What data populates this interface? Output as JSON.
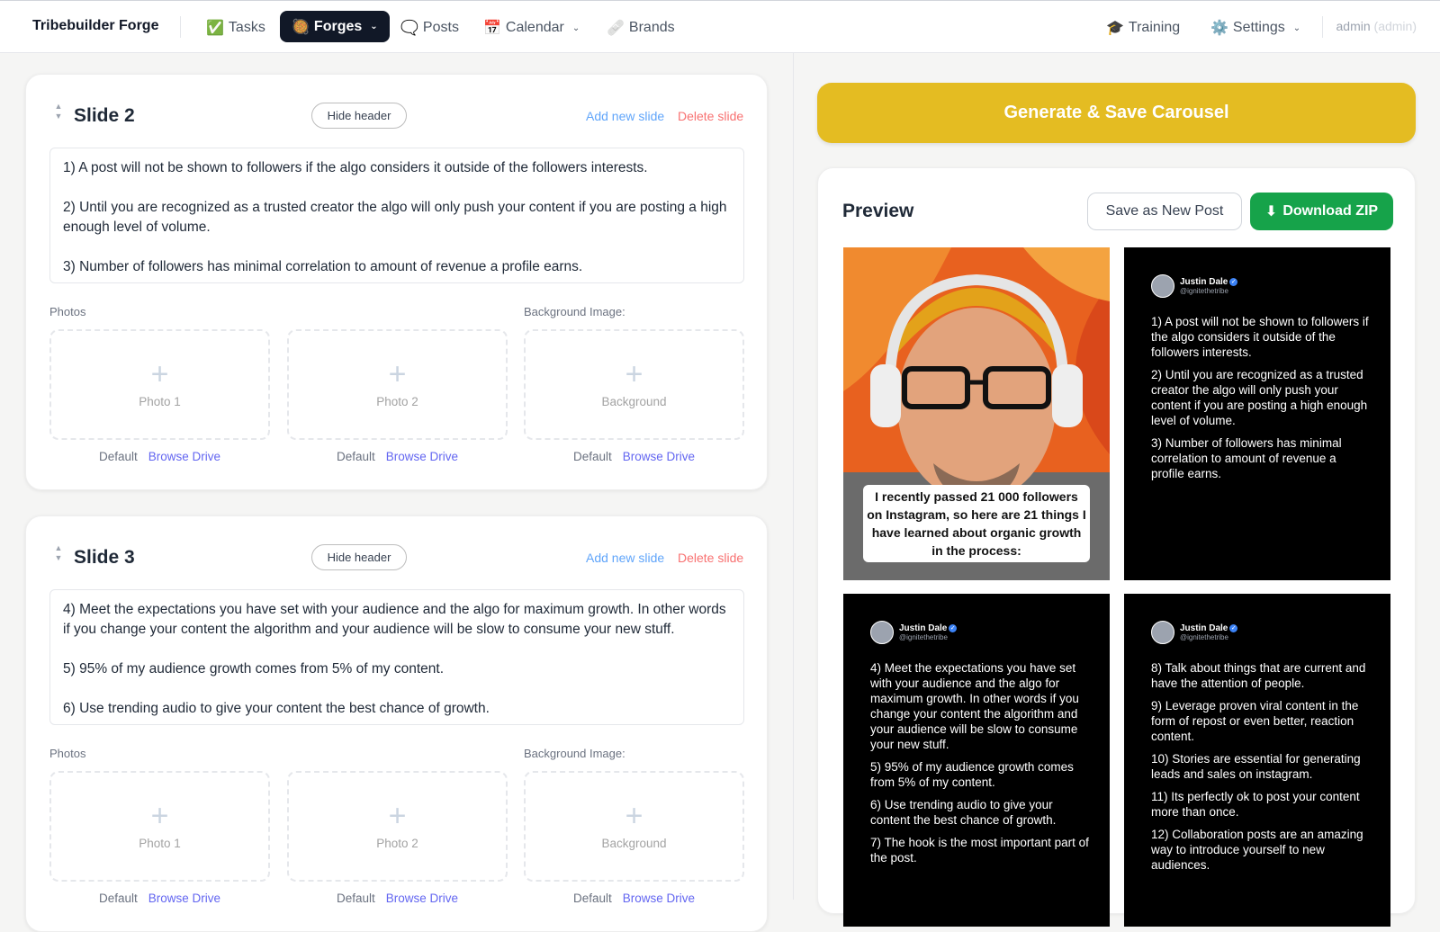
{
  "nav": {
    "brand": "Tribebuilder Forge",
    "items": [
      {
        "icon": "✅",
        "label": "Tasks"
      },
      {
        "icon": "🥘",
        "label": "Forges"
      },
      {
        "icon": "🗨️",
        "label": "Posts"
      },
      {
        "icon": "📅",
        "label": "Calendar"
      },
      {
        "icon": "🩹",
        "label": "Brands"
      }
    ],
    "training": {
      "icon": "🎓",
      "label": "Training"
    },
    "settings": {
      "icon": "⚙️",
      "label": "Settings"
    },
    "user": "admin",
    "role": "(admin)"
  },
  "slides": [
    {
      "title": "Slide 2",
      "hide_header": "Hide header",
      "add": "Add new slide",
      "delete": "Delete slide",
      "text": "1) A post will not be shown to followers if the algo considers it outside of the followers interests.\n\n2) Until you are recognized as a trusted creator the algo will only push your content if you are posting a high enough level of volume.\n\n3) Number of followers has minimal correlation to amount of revenue a profile earns.",
      "photos_label": "Photos",
      "bg_label": "Background Image:",
      "drops": [
        "Photo 1",
        "Photo 2",
        "Background"
      ],
      "default": "Default",
      "browse": "Browse Drive"
    },
    {
      "title": "Slide 3",
      "hide_header": "Hide header",
      "add": "Add new slide",
      "delete": "Delete slide",
      "text": "4) Meet the expectations you have set with your audience and the algo for maximum growth. In other words if you change your content the algorithm and your audience will be slow to consume your new stuff.\n\n5) 95% of my audience growth comes from 5% of my content.\n\n6) Use trending audio to give your content the best chance of growth.",
      "photos_label": "Photos",
      "bg_label": "Background Image:",
      "drops": [
        "Photo 1",
        "Photo 2",
        "Background"
      ],
      "default": "Default",
      "browse": "Browse Drive"
    }
  ],
  "generate": "Generate & Save Carousel",
  "preview": {
    "title": "Preview",
    "save": "Save as New Post",
    "zip": "Download ZIP",
    "caption": "I recently passed 21 000 followers on Instagram, so here are 21 things I have learned about organic growth in the process:",
    "author": "Justin Dale",
    "handle": "@ignitethetribe",
    "tile2": [
      "1) A post will not be shown to followers if the algo considers it outside of the followers interests.",
      "2) Until you are recognized as a trusted creator the algo will only push your content if you are posting a high enough level of volume.",
      "3) Number of followers has minimal correlation to amount of revenue a profile earns."
    ],
    "tile3": [
      "4) Meet the expectations you have set with your audience and the algo for maximum growth. In other words if you change your content the algorithm and your audience will be slow to consume your new stuff.",
      "5) 95% of my audience growth comes from 5% of my content.",
      "6) Use trending audio to give your content the best chance of growth.",
      "7) The hook is the most important part of the post."
    ],
    "tile4": [
      "8) Talk about things that are current and have the attention of people.",
      "9) Leverage proven viral content in the form of repost or even better, reaction content.",
      "10) Stories are essential for generating leads and sales on instagram.",
      "11) Its perfectly ok to post your content more than once.",
      "12) Collaboration posts are an amazing way to introduce yourself to new audiences."
    ]
  }
}
